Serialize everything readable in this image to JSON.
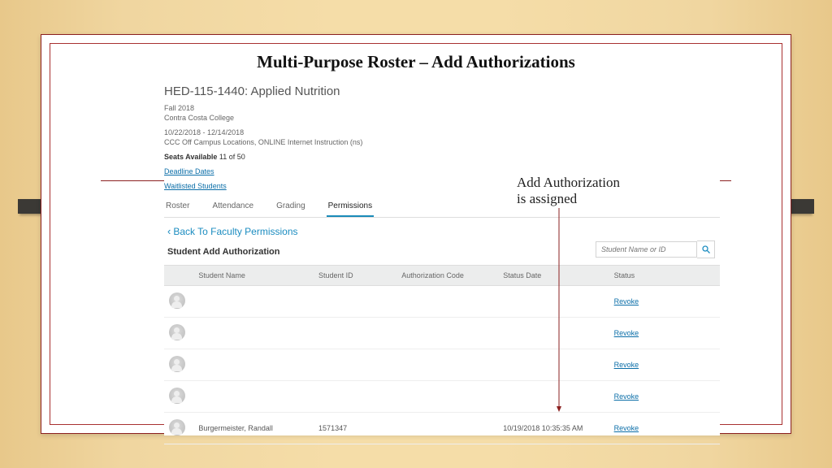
{
  "slide": {
    "title": "Multi-Purpose Roster – Add Authorizations",
    "annotation_line1": "Add Authorization",
    "annotation_line2": "is assigned"
  },
  "course": {
    "code_title": "HED-115-1440: Applied Nutrition",
    "term": "Fall 2018",
    "college": "Contra Costa College",
    "date_range": "10/22/2018 - 12/14/2018",
    "location": "CCC Off Campus Locations, ONLINE Internet Instruction (ns)",
    "seats_label": "Seats Available",
    "seats_value": "11 of 50",
    "deadline_link": "Deadline Dates",
    "waitlist_link": "Waitlisted Students"
  },
  "tabs": {
    "roster": "Roster",
    "attendance": "Attendance",
    "grading": "Grading",
    "permissions": "Permissions"
  },
  "permissions": {
    "back_link": "Back To Faculty Permissions",
    "section_title": "Student Add Authorization",
    "search_placeholder": "Student Name or ID"
  },
  "table": {
    "headers": {
      "name": "Student Name",
      "id": "Student ID",
      "auth": "Authorization Code",
      "date": "Status Date",
      "status": "Status"
    },
    "rows": [
      {
        "name": "",
        "id": "",
        "auth": "",
        "date": "",
        "status": "Revoke"
      },
      {
        "name": "",
        "id": "",
        "auth": "",
        "date": "",
        "status": "Revoke"
      },
      {
        "name": "",
        "id": "",
        "auth": "",
        "date": "",
        "status": "Revoke"
      },
      {
        "name": "",
        "id": "",
        "auth": "",
        "date": "",
        "status": "Revoke"
      },
      {
        "name": "Burgermeister, Randall",
        "id": "1571347",
        "auth": "",
        "date": "10/19/2018 10:35:35 AM",
        "status": "Revoke"
      }
    ]
  }
}
